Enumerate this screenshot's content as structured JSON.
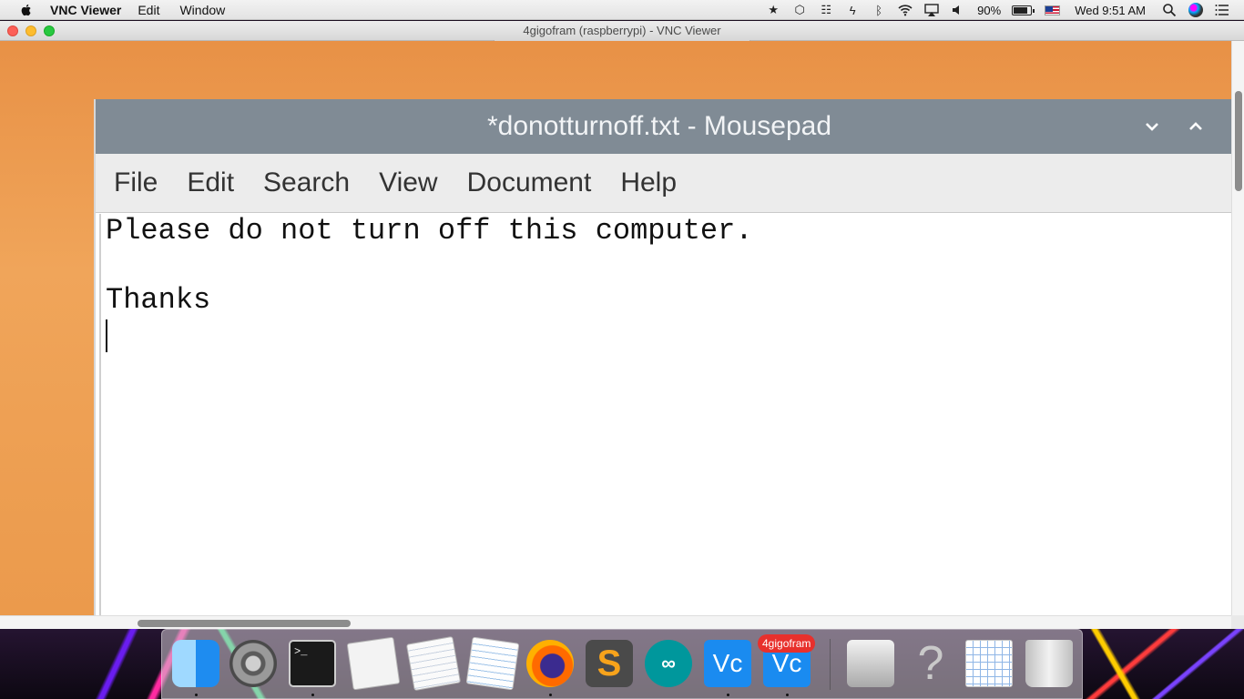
{
  "menubar": {
    "app_name": "VNC Viewer",
    "items": [
      "Edit",
      "Window"
    ],
    "battery_percent": "90%",
    "battery_level": 0.9,
    "clock": "Wed 9:51 AM",
    "status_icons": [
      "star-icon",
      "cube-icon",
      "drive-icon",
      "bolt-icon",
      "bluetooth-icon",
      "wifi-icon",
      "airplay-icon",
      "volume-icon",
      "us-flag-icon",
      "spotlight-icon",
      "siri-icon",
      "notification-center-icon"
    ]
  },
  "vnc_window": {
    "title": "4gigofram (raspberrypi) - VNC Viewer"
  },
  "mousepad": {
    "title": "*donotturnoff.txt - Mousepad",
    "menu": [
      "File",
      "Edit",
      "Search",
      "View",
      "Document",
      "Help"
    ],
    "lines": [
      "Please do not turn off this computer.",
      "",
      "Thanks",
      ""
    ]
  },
  "dock": {
    "apps": [
      {
        "name": "Finder",
        "icon": "finder-icon",
        "running": true
      },
      {
        "name": "System Preferences",
        "icon": "system-preferences-icon",
        "running": false
      },
      {
        "name": "Terminal",
        "icon": "terminal-icon",
        "running": true,
        "glyph": ">_"
      },
      {
        "name": "Script Editor",
        "icon": "script-editor-icon",
        "running": false
      },
      {
        "name": "Text Document",
        "icon": "document-icon",
        "running": false
      },
      {
        "name": "TextEdit",
        "icon": "textedit-icon",
        "running": false
      },
      {
        "name": "Firefox",
        "icon": "firefox-icon",
        "running": true
      },
      {
        "name": "Sublime Text",
        "icon": "sublime-text-icon",
        "running": false,
        "glyph": "S"
      },
      {
        "name": "Arduino",
        "icon": "arduino-icon",
        "running": false,
        "glyph": "∞"
      },
      {
        "name": "VNC Viewer",
        "icon": "vnc-viewer-icon",
        "running": true,
        "glyph": "Vc"
      },
      {
        "name": "VNC Viewer",
        "icon": "vnc-viewer-icon",
        "running": true,
        "glyph": "Vc",
        "badge": "4gigofram"
      },
      {
        "name": "Preview",
        "icon": "preview-icon",
        "running": false
      },
      {
        "name": "Help",
        "icon": "help-icon",
        "running": false,
        "glyph": "?"
      },
      {
        "name": "Calendar Document",
        "icon": "calendar-document-icon",
        "running": false
      },
      {
        "name": "Trash",
        "icon": "trash-icon",
        "running": false
      }
    ]
  },
  "colors": {
    "mousepad_titlebar": "#808b95",
    "desktop_orange": "#f0a55a"
  }
}
